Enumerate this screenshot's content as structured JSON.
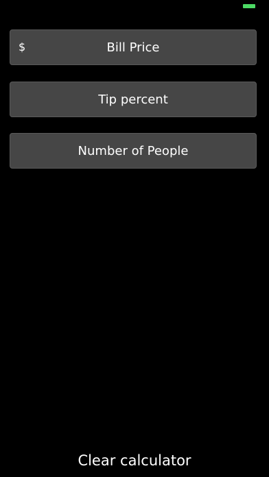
{
  "status_bar": {
    "battery_color": "#4cd964",
    "battery_icon": "battery-icon"
  },
  "form": {
    "bill": {
      "currency_symbol": "$",
      "placeholder": "Bill Price",
      "value": ""
    },
    "tip": {
      "placeholder": "Tip percent",
      "value": ""
    },
    "people": {
      "placeholder": "Number of People",
      "value": ""
    }
  },
  "actions": {
    "clear_label": "Clear calculator"
  },
  "colors": {
    "background": "#000000",
    "field_background": "#464646",
    "text": "#ffffff"
  }
}
